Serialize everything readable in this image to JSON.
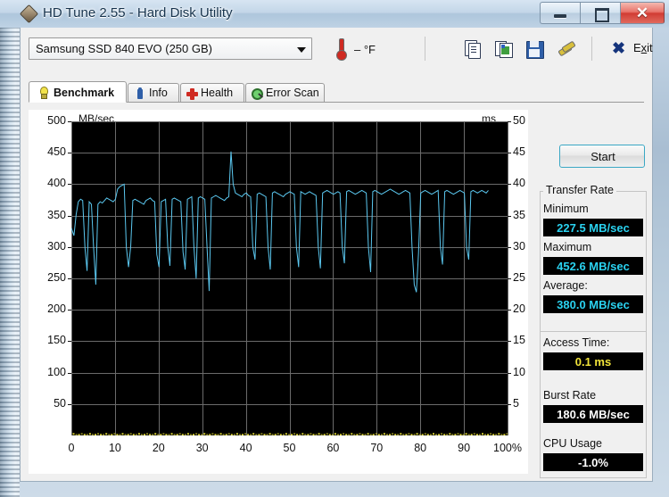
{
  "window": {
    "title": "HD Tune 2.55 - Hard Disk Utility",
    "icon": "hdtune-app-icon",
    "minimize": "minimize-icon",
    "maximize": "maximize-icon",
    "close": "✕"
  },
  "toolbar": {
    "drive_selected": "Samsung SSD 840 EVO (250 GB)",
    "temperature": "–  °F",
    "buttons": [
      {
        "name": "copy-text-icon",
        "tip": "Copy"
      },
      {
        "name": "copy-image-icon",
        "tip": "Copy image"
      },
      {
        "name": "save-icon",
        "tip": "Save"
      },
      {
        "name": "options-icon",
        "tip": "Options"
      }
    ],
    "exit_label_pre": "E",
    "exit_label_accel": "x",
    "exit_label_post": "it"
  },
  "tabs": [
    {
      "label": "Benchmark",
      "icon": "bulb-icon",
      "active": true
    },
    {
      "label": "Info",
      "icon": "info-icon",
      "active": false
    },
    {
      "label": "Health",
      "icon": "health-cross-icon",
      "active": false
    },
    {
      "label": "Error Scan",
      "icon": "magnifier-icon",
      "active": false
    }
  ],
  "results": {
    "start_label": "Start",
    "transfer_rate_group": "Transfer Rate",
    "minimum_label": "Minimum",
    "minimum_value": "227.5 MB/sec",
    "maximum_label": "Maximum",
    "maximum_value": "452.6 MB/sec",
    "average_label": "Average:",
    "average_value": "380.0 MB/sec",
    "access_time_label": "Access Time:",
    "access_time_value": "0.1 ms",
    "burst_rate_label": "Burst Rate",
    "burst_rate_value": "180.6 MB/sec",
    "cpu_usage_label": "CPU Usage",
    "cpu_usage_value": "-1.0%"
  },
  "colors": {
    "transfer_curve": "#5bc8f0",
    "access_dots": "#e8e03a",
    "value_cyan": "#2ad2f0",
    "value_yellow": "#f2e43a",
    "plot_background": "#000000",
    "grid": "#6b6b6b"
  },
  "chart_data": {
    "type": "line",
    "title": "",
    "xlabel": "",
    "ylabel": "MB/sec",
    "y2label": "ms",
    "xlim": [
      0,
      100
    ],
    "ylim": [
      0,
      500
    ],
    "y2lim": [
      0,
      50
    ],
    "grid": true,
    "xticks": [
      0,
      10,
      20,
      30,
      40,
      50,
      60,
      70,
      80,
      90,
      100
    ],
    "xticklabels": [
      "0",
      "10",
      "20",
      "30",
      "40",
      "50",
      "60",
      "70",
      "80",
      "90",
      "100%"
    ],
    "yticks": [
      50,
      100,
      150,
      200,
      250,
      300,
      350,
      400,
      450,
      500
    ],
    "y2ticks": [
      5,
      10,
      15,
      20,
      25,
      30,
      35,
      40,
      45,
      50
    ],
    "series": [
      {
        "name": "Transfer rate",
        "axis": "left",
        "color": "#5bc8f0",
        "x": [
          0.0,
          0.6,
          1.1,
          1.6,
          2.1,
          2.6,
          3.1,
          3.6,
          4.1,
          4.6,
          5.1,
          5.6,
          6.1,
          6.6,
          7.1,
          7.6,
          8.1,
          8.6,
          9.1,
          9.6,
          10.1,
          10.6,
          11.1,
          11.6,
          12.1,
          12.6,
          13.1,
          13.6,
          14.1,
          14.6,
          15.1,
          15.6,
          16.1,
          16.6,
          17.1,
          17.6,
          18.1,
          18.6,
          19.1,
          19.6,
          20.1,
          20.6,
          21.1,
          21.6,
          22.1,
          22.6,
          23.1,
          23.6,
          24.1,
          24.6,
          25.1,
          25.6,
          26.1,
          26.6,
          27.1,
          27.6,
          28.1,
          28.6,
          29.1,
          29.6,
          30.1,
          30.6,
          31.1,
          31.6,
          32.1,
          32.6,
          33.1,
          33.6,
          34.1,
          34.6,
          35.1,
          35.6,
          36.1,
          36.6,
          37.1,
          37.6,
          38.1,
          38.6,
          39.1,
          39.6,
          40.1,
          40.6,
          41.1,
          41.6,
          42.1,
          42.6,
          43.1,
          43.6,
          44.1,
          44.6,
          45.1,
          45.6,
          46.1,
          46.6,
          47.1,
          47.6,
          48.1,
          48.6,
          49.1,
          49.6,
          50.1,
          50.6,
          51.1,
          51.6,
          52.1,
          52.6,
          53.1,
          53.6,
          54.1,
          54.6,
          55.1,
          55.6,
          56.1,
          56.6,
          57.1,
          57.6,
          58.1,
          58.6,
          59.1,
          59.6,
          60.1,
          60.6,
          61.1,
          61.6,
          62.1,
          62.6,
          63.1,
          63.6,
          64.1,
          64.6,
          65.1,
          65.6,
          66.1,
          66.6,
          67.1,
          67.6,
          68.1,
          68.6,
          69.1,
          69.6,
          70.1,
          70.6,
          71.1,
          71.6,
          72.1,
          72.6,
          73.1,
          73.6,
          74.1,
          74.6,
          75.1,
          75.6,
          76.1,
          76.6,
          77.1,
          77.6,
          78.1,
          78.6,
          79.1,
          79.6,
          80.1,
          80.6,
          81.1,
          81.6,
          82.1,
          82.6,
          83.1,
          83.6,
          84.1,
          84.6,
          85.1,
          85.6,
          86.1,
          86.6,
          87.1,
          87.6,
          88.1,
          88.6,
          89.1,
          89.6,
          90.1,
          90.6,
          91.1,
          91.6,
          92.1,
          92.6,
          93.1,
          93.6,
          94.1,
          94.6,
          95.1,
          95.6,
          96.1,
          96.6,
          97.1,
          97.6,
          98.1,
          98.6,
          99.1,
          99.6
        ],
        "y": [
          330,
          318,
          352,
          372,
          376,
          374,
          300,
          262,
          372,
          368,
          300,
          240,
          368,
          372,
          370,
          374,
          378,
          376,
          374,
          372,
          376,
          392,
          396,
          398,
          400,
          300,
          268,
          300,
          374,
          376,
          374,
          372,
          370,
          368,
          374,
          376,
          378,
          374,
          372,
          288,
          268,
          372,
          374,
          376,
          300,
          270,
          376,
          378,
          376,
          374,
          372,
          292,
          264,
          376,
          378,
          380,
          300,
          250,
          378,
          380,
          378,
          376,
          300,
          230,
          378,
          380,
          382,
          380,
          378,
          376,
          374,
          378,
          380,
          452,
          400,
          386,
          384,
          382,
          380,
          384,
          386,
          382,
          380,
          300,
          280,
          384,
          386,
          384,
          382,
          380,
          300,
          264,
          386,
          388,
          386,
          384,
          382,
          380,
          384,
          386,
          388,
          386,
          384,
          300,
          268,
          388,
          386,
          384,
          386,
          388,
          386,
          384,
          382,
          300,
          266,
          386,
          388,
          390,
          388,
          386,
          384,
          386,
          388,
          386,
          300,
          274,
          388,
          390,
          388,
          386,
          384,
          386,
          388,
          390,
          388,
          386,
          300,
          260,
          388,
          390,
          388,
          386,
          384,
          386,
          388,
          390,
          392,
          390,
          388,
          386,
          384,
          386,
          388,
          390,
          388,
          386,
          300,
          240,
          228,
          290,
          386,
          388,
          390,
          388,
          386,
          384,
          386,
          388,
          390,
          300,
          272,
          388,
          390,
          388,
          386,
          384,
          386,
          388,
          390,
          388,
          386,
          300,
          280,
          388,
          390,
          388,
          386,
          388,
          390,
          388,
          386,
          390
        ]
      },
      {
        "name": "Access time",
        "axis": "right",
        "color": "#e8e03a",
        "value_ms": 0.1
      }
    ]
  }
}
